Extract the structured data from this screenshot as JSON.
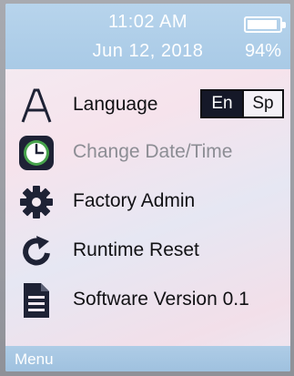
{
  "status": {
    "time": "11:02 AM",
    "date": "Jun 12, 2018",
    "battery_percent": "94%",
    "battery_level": 0.94,
    "battery_icon": "battery-icon"
  },
  "menu": {
    "items": [
      {
        "id": "language",
        "label": "Language",
        "icon": "letter-a-icon",
        "enabled": true
      },
      {
        "id": "datetime",
        "label": "Change Date/Time",
        "icon": "clock-icon",
        "enabled": false
      },
      {
        "id": "factory",
        "label": "Factory Admin",
        "icon": "gear-icon",
        "enabled": true
      },
      {
        "id": "runtime",
        "label": "Runtime Reset",
        "icon": "refresh-icon",
        "enabled": true
      },
      {
        "id": "software",
        "label": "Software Version 0.1",
        "icon": "document-icon",
        "enabled": true
      }
    ],
    "language_options": [
      {
        "label": "En",
        "selected": true
      },
      {
        "label": "Sp",
        "selected": false
      }
    ]
  },
  "footer": {
    "label": "Menu"
  },
  "colors": {
    "header": "#b7d4ec",
    "footer": "#aecce6",
    "selected_lang_bg": "#151828",
    "clock_ring": "#47a34c",
    "icon_dark": "#1e2235"
  }
}
